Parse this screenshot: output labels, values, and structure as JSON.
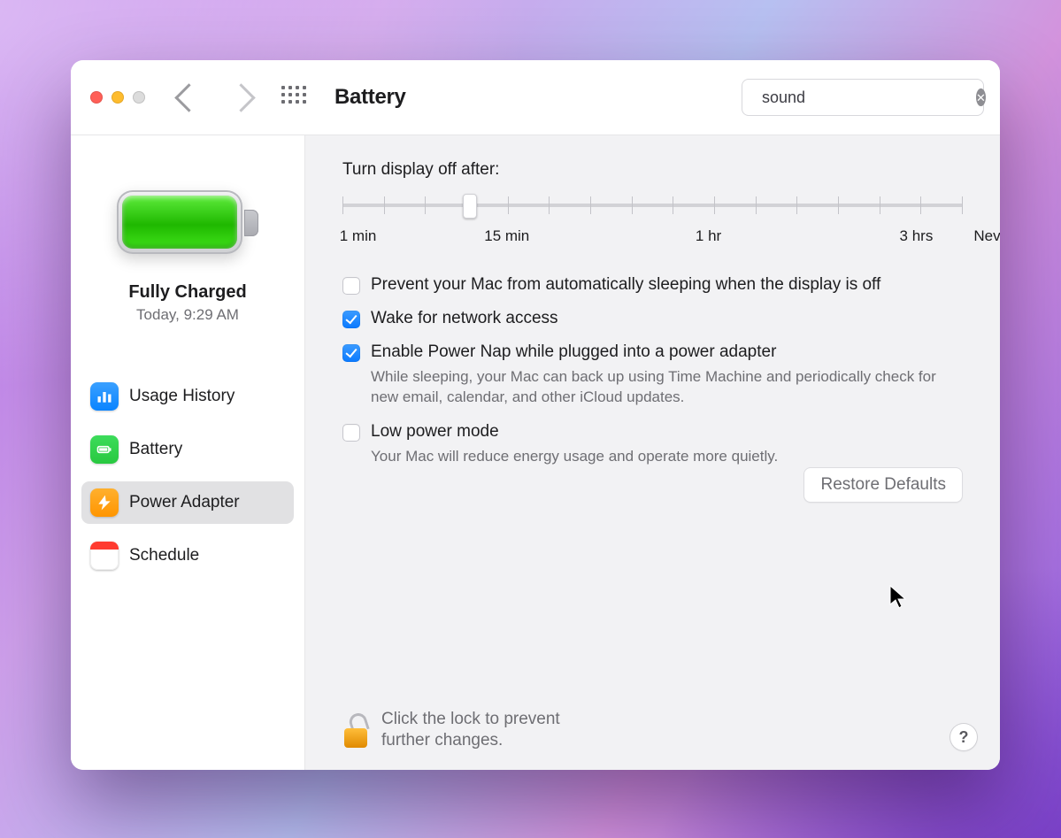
{
  "window": {
    "title": "Battery"
  },
  "search": {
    "value": "sound"
  },
  "sidebar": {
    "status_title": "Fully Charged",
    "status_sub": "Today, 9:29 AM",
    "items": [
      {
        "label": "Usage History"
      },
      {
        "label": "Battery"
      },
      {
        "label": "Power Adapter"
      },
      {
        "label": "Schedule"
      }
    ],
    "selected_index": 2
  },
  "slider": {
    "title": "Turn display off after:",
    "tick_count": 16,
    "labels": [
      {
        "text": "1 min",
        "pos_pct": 2.5
      },
      {
        "text": "15 min",
        "pos_pct": 26.5
      },
      {
        "text": "1 hr",
        "pos_pct": 59.0
      },
      {
        "text": "3 hrs",
        "pos_pct": 92.5
      },
      {
        "text": "Never",
        "pos_pct": 105.0
      }
    ],
    "thumb_pos_pct": 20.5
  },
  "options": [
    {
      "checked": false,
      "title": "Prevent your Mac from automatically sleeping when the display is off",
      "sub": ""
    },
    {
      "checked": true,
      "title": "Wake for network access",
      "sub": ""
    },
    {
      "checked": true,
      "title": "Enable Power Nap while plugged into a power adapter",
      "sub": "While sleeping, your Mac can back up using Time Machine and periodically check for new email, calendar, and other iCloud updates."
    },
    {
      "checked": false,
      "title": "Low power mode",
      "sub": "Your Mac will reduce energy usage and operate more quietly."
    }
  ],
  "buttons": {
    "restore_defaults": "Restore Defaults"
  },
  "lock_hint": "Click the lock to prevent further changes."
}
